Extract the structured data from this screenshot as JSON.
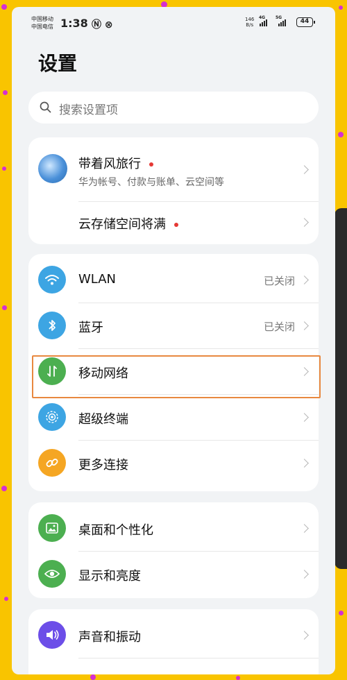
{
  "status_bar": {
    "carrier_1": "中国移动",
    "carrier_2": "中国电信",
    "time": "1:38",
    "net_speed_value": "146",
    "net_speed_unit": "B/s",
    "net_1": "4G",
    "net_2": "5G",
    "battery": "44"
  },
  "page": {
    "title": "设置"
  },
  "search": {
    "placeholder": "搜索设置项"
  },
  "account": {
    "name": "带着风旅行",
    "subtitle": "华为帐号、付款与账单、云空间等",
    "cloud_storage": "云存储空间将满"
  },
  "connectivity": {
    "items": [
      {
        "label": "WLAN",
        "value": "已关闭",
        "icon": "wifi-icon",
        "color": "#3da5e3"
      },
      {
        "label": "蓝牙",
        "value": "已关闭",
        "icon": "bluetooth-icon",
        "color": "#3da5e3"
      },
      {
        "label": "移动网络",
        "value": "",
        "icon": "mobile-network-icon",
        "color": "#4caf50"
      },
      {
        "label": "超级终端",
        "value": "",
        "icon": "super-device-icon",
        "color": "#3da5e3"
      },
      {
        "label": "更多连接",
        "value": "",
        "icon": "link-icon",
        "color": "#f5a623"
      }
    ]
  },
  "display": {
    "items": [
      {
        "label": "桌面和个性化",
        "icon": "wallpaper-icon",
        "color": "#4caf50"
      },
      {
        "label": "显示和亮度",
        "icon": "eye-icon",
        "color": "#4caf50"
      }
    ]
  },
  "sound": {
    "items": [
      {
        "label": "声音和振动",
        "icon": "speaker-icon",
        "color": "#6c4ee8"
      }
    ]
  }
}
